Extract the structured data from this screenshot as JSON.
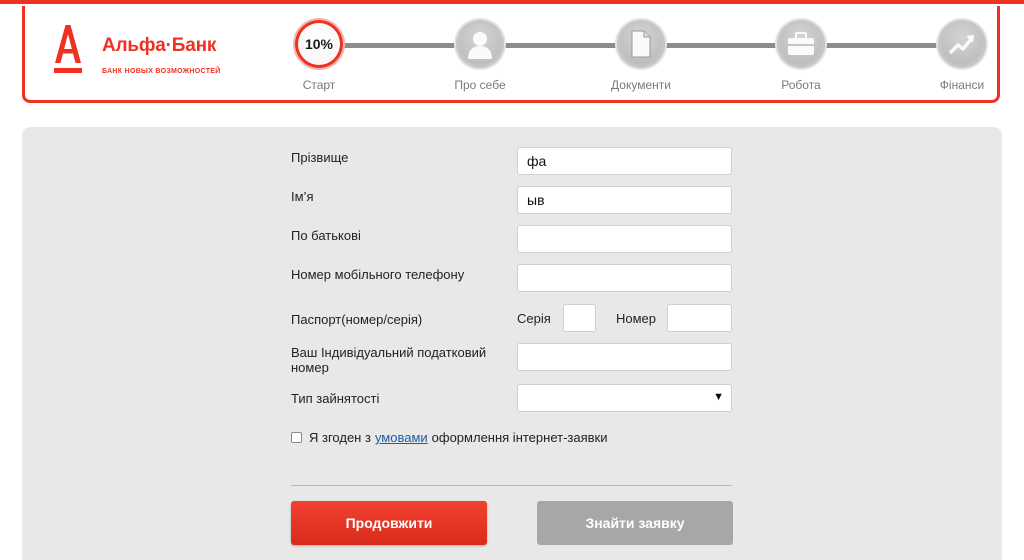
{
  "brand": {
    "name": "Альфа·Банк",
    "slogan": "БАНК НОВЫХ ВОЗМОЖНОСТЕЙ",
    "color": "#ef3124"
  },
  "progress": {
    "value_text": "10%",
    "value_percent": 10,
    "steps": [
      {
        "label": "Старт",
        "icon": "progress-percent",
        "active": true
      },
      {
        "label": "Про себе",
        "icon": "person-icon",
        "active": false
      },
      {
        "label": "Документи",
        "icon": "document-icon",
        "active": false
      },
      {
        "label": "Робота",
        "icon": "briefcase-icon",
        "active": false
      },
      {
        "label": "Фінанси",
        "icon": "chart-up-icon",
        "active": false
      }
    ]
  },
  "form": {
    "surname": {
      "label": "Прізвище",
      "value": "фа"
    },
    "name": {
      "label": "Ім’я",
      "value": "ыв"
    },
    "patronymic": {
      "label": "По батькові",
      "value": ""
    },
    "phone": {
      "label": "Номер мобільного телефону",
      "value": ""
    },
    "passport": {
      "label": "Паспорт(номер/серія)",
      "series_label": "Серія",
      "series_value": "",
      "number_label": "Номер",
      "number_value": ""
    },
    "tax_id": {
      "label": "Ваш Індивідуальний податковий номер",
      "value": ""
    },
    "employment": {
      "label": "Тип зайнятості",
      "value": "",
      "arrow": "▼"
    },
    "agree": {
      "before": "Я згоден з",
      "link": "умовами",
      "after": "оформлення інтернет-заявки",
      "checked": false
    }
  },
  "buttons": {
    "continue": "Продовжити",
    "find": "Знайти заявку"
  }
}
